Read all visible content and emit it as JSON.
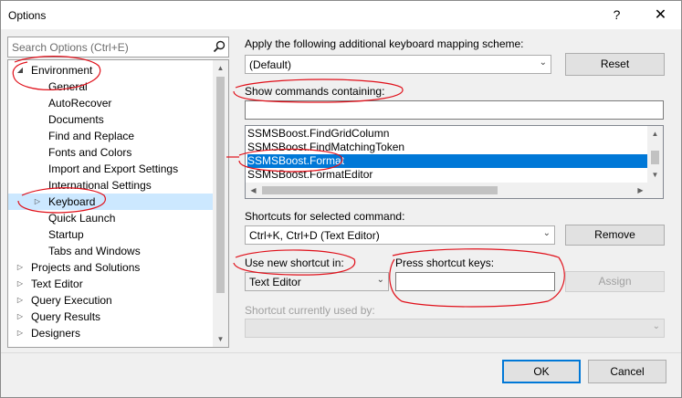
{
  "window": {
    "title": "Options",
    "help_glyph": "?",
    "close_glyph": "✕"
  },
  "search": {
    "placeholder": "Search Options (Ctrl+E)"
  },
  "tree": {
    "items": [
      {
        "label": "Environment",
        "level": 0,
        "expander": "◢"
      },
      {
        "label": "General",
        "level": 1
      },
      {
        "label": "AutoRecover",
        "level": 1
      },
      {
        "label": "Documents",
        "level": 1
      },
      {
        "label": "Find and Replace",
        "level": 1
      },
      {
        "label": "Fonts and Colors",
        "level": 1
      },
      {
        "label": "Import and Export Settings",
        "level": 1
      },
      {
        "label": "International Settings",
        "level": 1
      },
      {
        "label": "Keyboard",
        "level": 1,
        "expander": "▷",
        "selected": true
      },
      {
        "label": "Quick Launch",
        "level": 1
      },
      {
        "label": "Startup",
        "level": 1
      },
      {
        "label": "Tabs and Windows",
        "level": 1
      },
      {
        "label": "Projects and Solutions",
        "level": 0,
        "expander": "▷"
      },
      {
        "label": "Text Editor",
        "level": 0,
        "expander": "▷"
      },
      {
        "label": "Query Execution",
        "level": 0,
        "expander": "▷"
      },
      {
        "label": "Query Results",
        "level": 0,
        "expander": "▷"
      },
      {
        "label": "Designers",
        "level": 0,
        "expander": "▷"
      }
    ]
  },
  "mapping": {
    "label": "Apply the following additional keyboard mapping scheme:",
    "value": "(Default)",
    "reset_label": "Reset"
  },
  "commands": {
    "label": "Show commands containing:",
    "filter_value": "",
    "items": [
      "SSMSBoost.FindGridColumn",
      "SSMSBoost.FindMatchingToken",
      "SSMSBoost.Format",
      "SSMSBoost.FormatEditor"
    ],
    "selected_index": 2
  },
  "shortcuts": {
    "label": "Shortcuts for selected command:",
    "value": "Ctrl+K, Ctrl+D (Text Editor)",
    "remove_label": "Remove"
  },
  "new_shortcut": {
    "use_in_label": "Use new shortcut in:",
    "use_in_value": "Text Editor",
    "press_keys_label": "Press shortcut keys:",
    "press_keys_value": "",
    "assign_label": "Assign"
  },
  "used_by": {
    "label": "Shortcut currently used by:",
    "value": ""
  },
  "footer": {
    "ok_label": "OK",
    "cancel_label": "Cancel"
  },
  "colors": {
    "selection": "#0078d7",
    "tree_selection": "#cce8ff",
    "annotation": "#e0101a"
  }
}
